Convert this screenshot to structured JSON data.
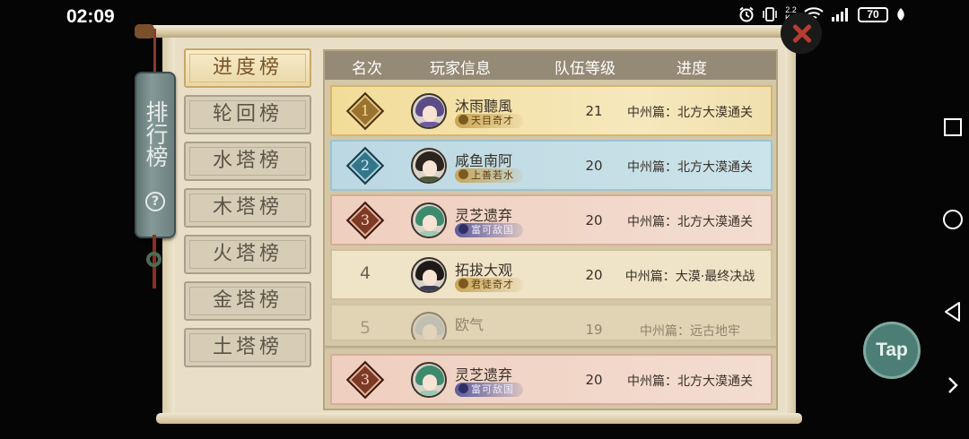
{
  "status_bar": {
    "time": "02:09",
    "speed_value": "2.2",
    "speed_unit": "K/s",
    "battery": "70",
    "icons": [
      "alarm-icon",
      "vibrate-icon",
      "wifi-icon",
      "signal-icon",
      "battery-icon",
      "leaf-icon"
    ]
  },
  "panel": {
    "title": "排行榜",
    "help_label": "?"
  },
  "tabs": [
    {
      "label": "进度榜",
      "active": true
    },
    {
      "label": "轮回榜",
      "active": false
    },
    {
      "label": "水塔榜",
      "active": false
    },
    {
      "label": "木塔榜",
      "active": false
    },
    {
      "label": "火塔榜",
      "active": false
    },
    {
      "label": "金塔榜",
      "active": false
    },
    {
      "label": "土塔榜",
      "active": false
    }
  ],
  "table": {
    "headers": {
      "rank": "名次",
      "player": "玩家信息",
      "level": "队伍等级",
      "progress": "进度"
    },
    "rows": [
      {
        "rank": "1",
        "name": "沐雨聽風",
        "title": "天目奇才",
        "level": "21",
        "progress": "中州篇：北方大漠通关",
        "style": "gold"
      },
      {
        "rank": "2",
        "name": "咸鱼南阿",
        "title": "上善若水",
        "level": "20",
        "progress": "中州篇：北方大漠通关",
        "style": "blue"
      },
      {
        "rank": "3",
        "name": "灵芝遗弃",
        "title": "富可敌国",
        "level": "20",
        "progress": "中州篇：北方大漠通关",
        "style": "pink"
      },
      {
        "rank": "4",
        "name": "拓拔大观",
        "title": "君徒奇才",
        "level": "20",
        "progress": "中州篇：大漠·最终决战",
        "style": "plain"
      },
      {
        "rank": "5",
        "name": "欧气",
        "title": "",
        "level": "19",
        "progress": "中州篇：远古地牢",
        "style": "faded"
      }
    ],
    "my_row": {
      "rank": "3",
      "name": "灵芝遗弃",
      "title": "富可敌国",
      "level": "20",
      "progress": "中州篇：北方大漠通关"
    }
  },
  "buttons": {
    "close": "close-icon",
    "tap_label": "Tap"
  }
}
